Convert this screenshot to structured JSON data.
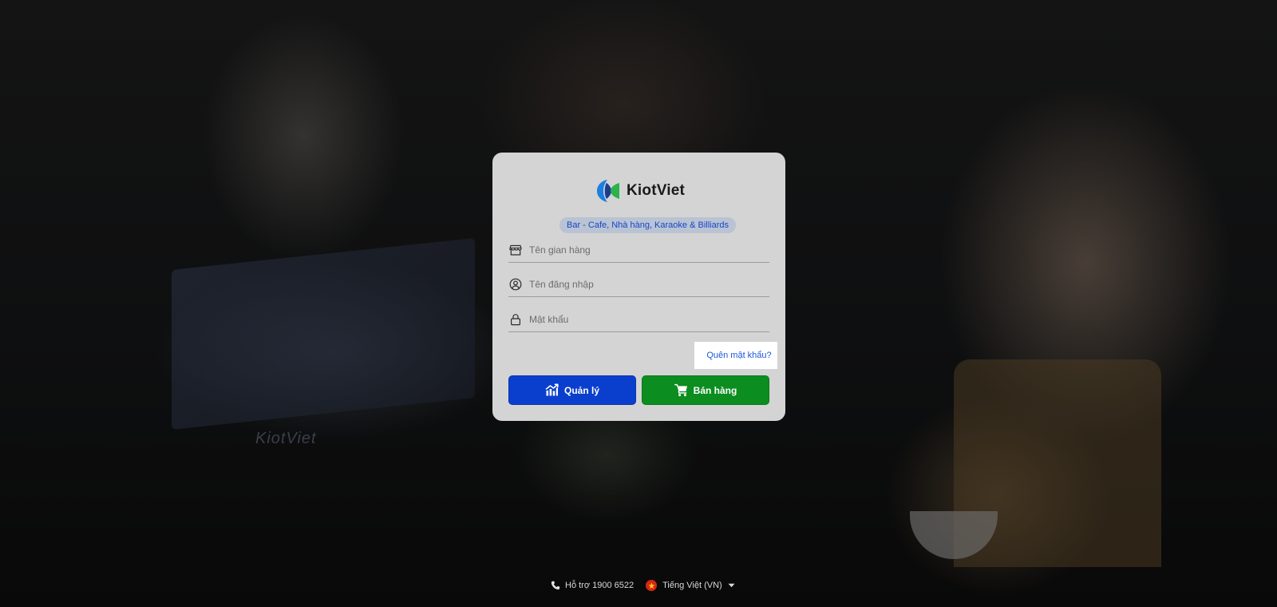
{
  "brand": {
    "name": "KiotViet",
    "subtitle": "Bar - Cafe, Nhà hàng, Karaoke & Billiards",
    "logo_colors": {
      "blue": "#1b7ee0",
      "green": "#2bb24c"
    },
    "watermark": "KiotViet"
  },
  "form": {
    "store_placeholder": "Tên gian hàng",
    "username_placeholder": "Tên đăng nhập",
    "password_placeholder": "Mật khẩu",
    "forgot_label": "Quên mật khẩu?",
    "manage_label": "Quản lý",
    "sell_label": "Bán hàng"
  },
  "icons": {
    "store": "store-icon",
    "user": "user-circle-icon",
    "lock": "lock-icon",
    "manage": "chart-icon",
    "sell": "cart-icon",
    "phone": "phone-icon",
    "flag": "vietnam-flag-icon",
    "caret": "caret-down-icon"
  },
  "colors": {
    "manage_button": "#0a3fce",
    "sell_button": "#0b8d1f",
    "link": "#1b57d8",
    "card_bg": "#d4d4d4"
  },
  "footer": {
    "support": "Hỗ trợ 1900 6522",
    "language": "Tiếng Việt (VN)"
  }
}
